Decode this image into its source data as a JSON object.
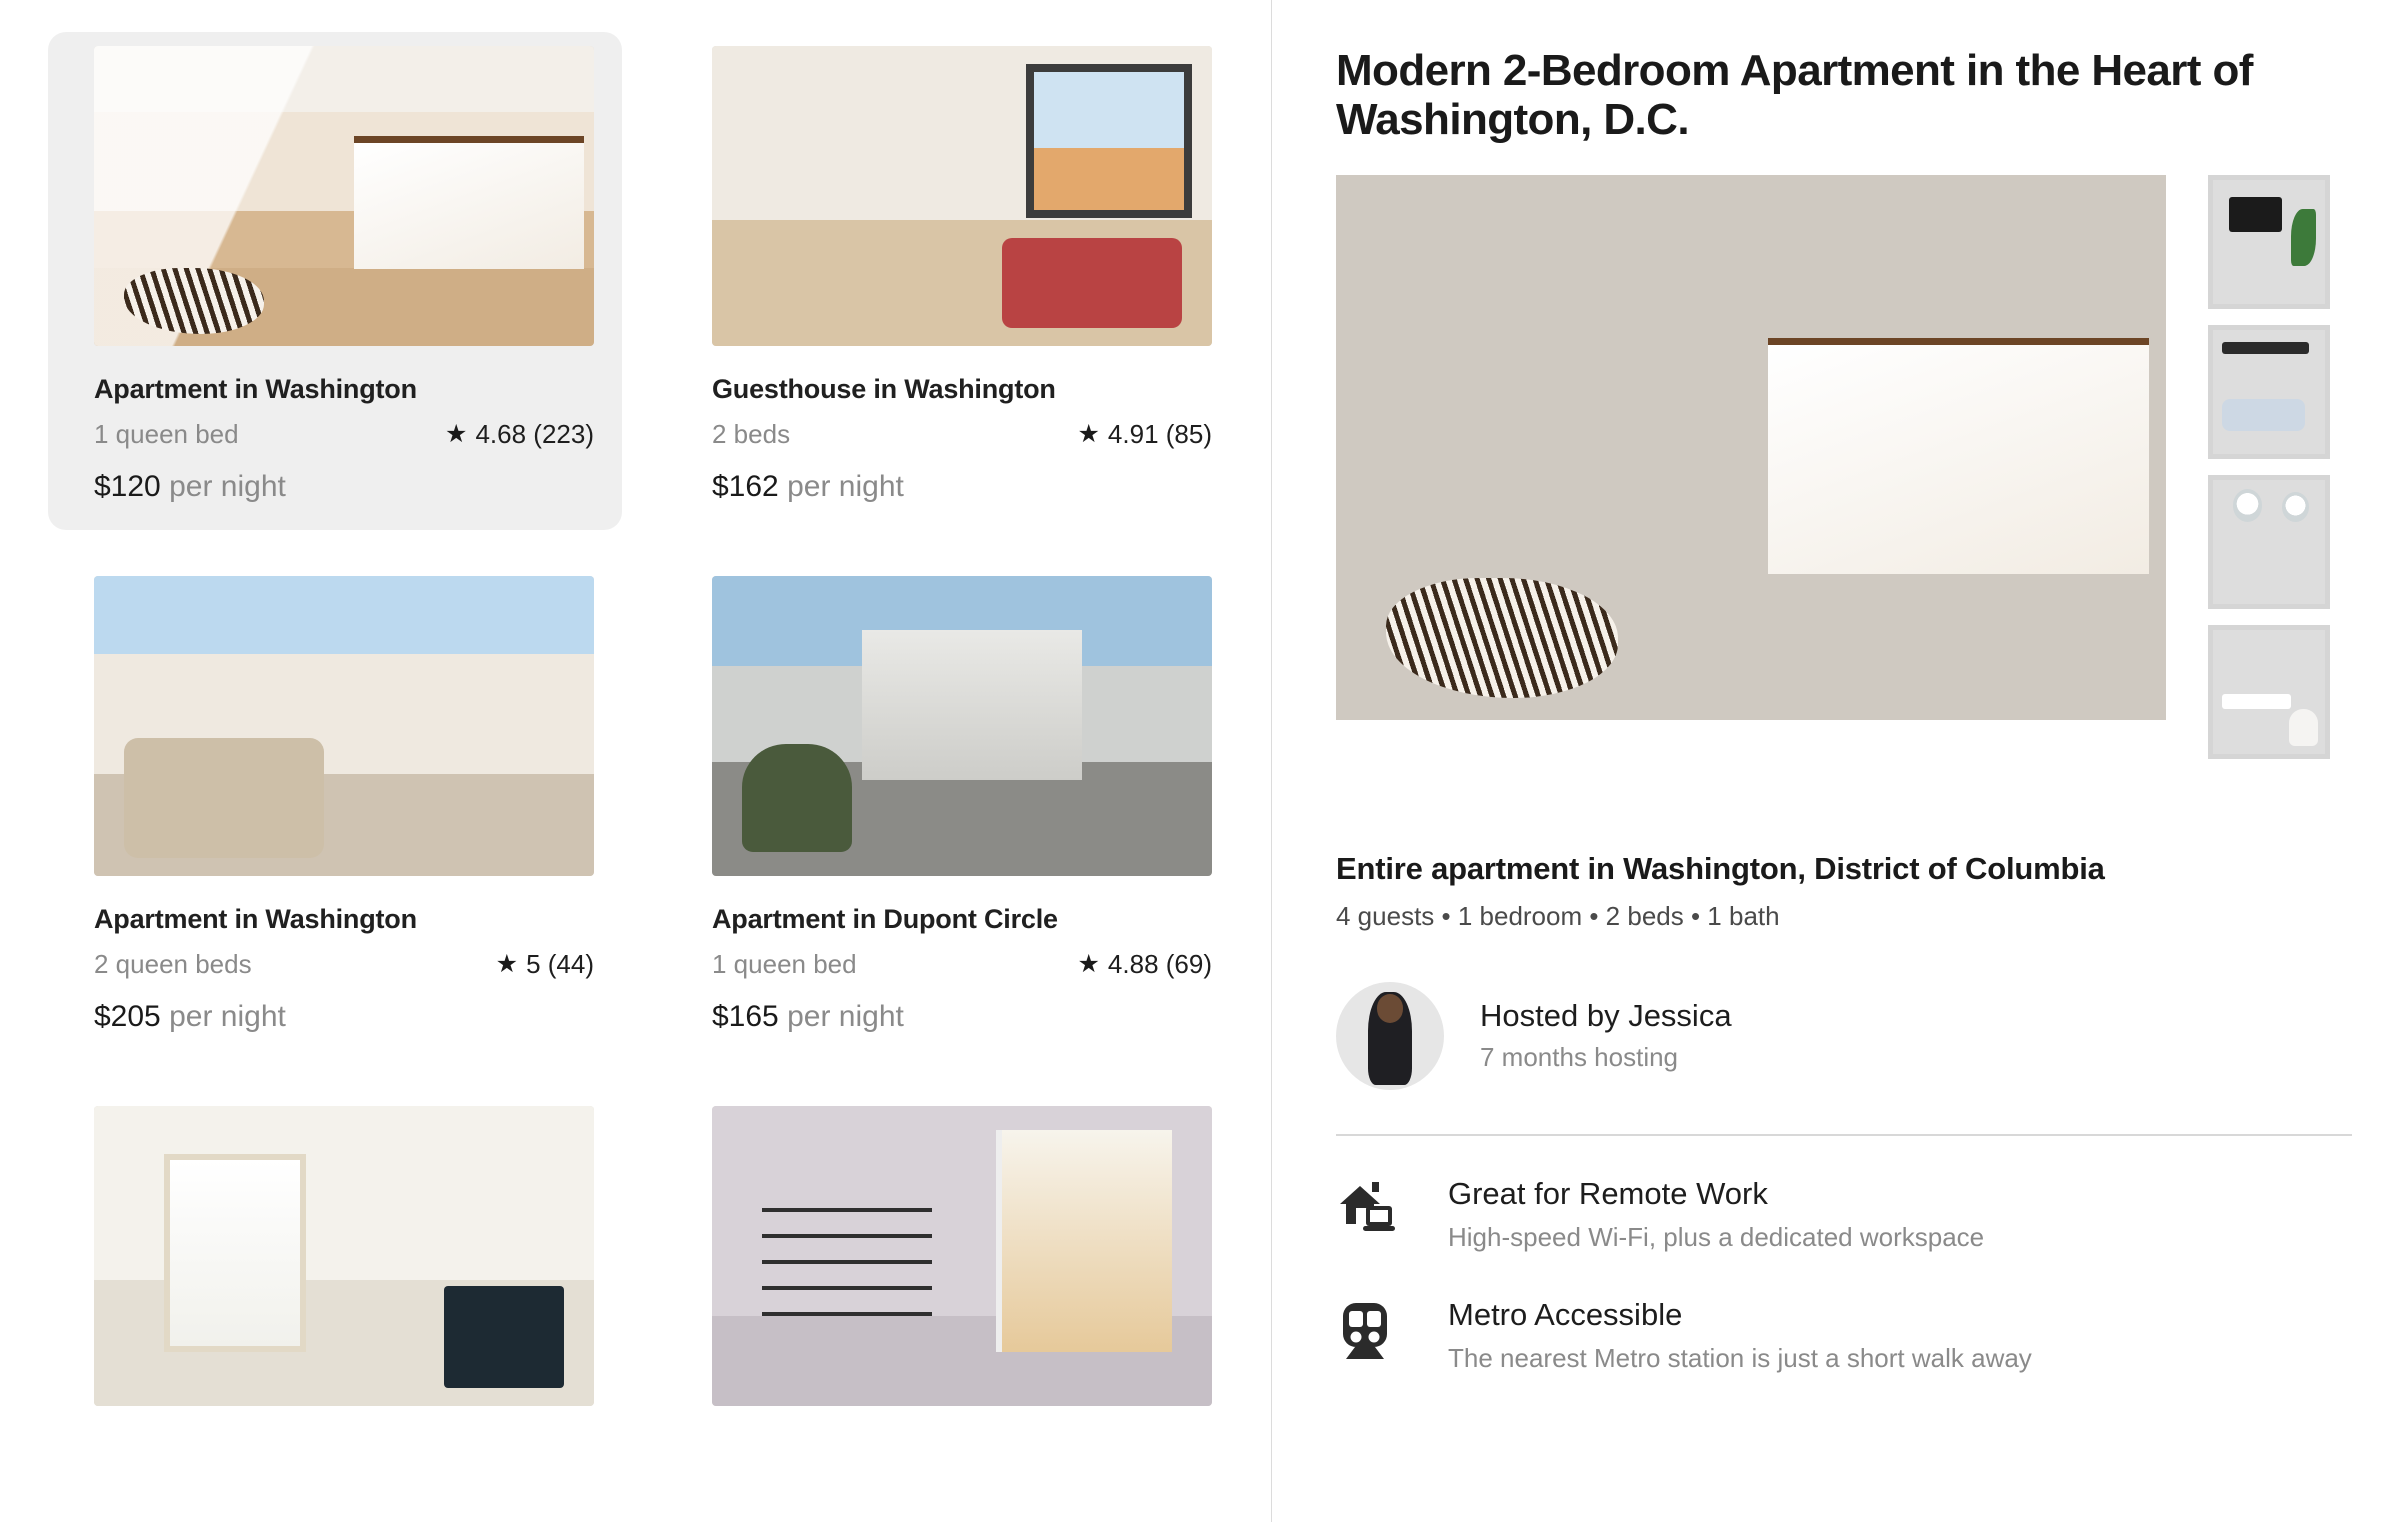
{
  "listings": [
    {
      "title": "Apartment in Washington",
      "beds": "1 queen bed",
      "rating": "4.68 (223)",
      "price_amount": "$120",
      "price_suffix": " per night",
      "selected": true,
      "photo": "bedroom-photo"
    },
    {
      "title": "Guesthouse in Washington",
      "beds": "2 beds",
      "rating": "4.91 (85)",
      "price_amount": "$162",
      "price_suffix": " per night",
      "selected": false,
      "photo": "guesthouse-photo"
    },
    {
      "title": "Apartment in Washington",
      "beds": "2 queen beds",
      "rating": "5 (44)",
      "price_amount": "$205",
      "price_suffix": " per night",
      "selected": false,
      "photo": "living-room-photo"
    },
    {
      "title": "Apartment in Dupont Circle",
      "beds": "1 queen bed",
      "rating": "4.88 (69)",
      "price_amount": "$165",
      "price_suffix": " per night",
      "selected": false,
      "photo": "balcony-photo"
    }
  ],
  "partial_listings": [
    {
      "photo": "curtained-window-photo"
    },
    {
      "photo": "shelves-window-photo"
    }
  ],
  "detail": {
    "title": "Modern 2-Bedroom Apartment in the Heart of Washington, D.C.",
    "hero_photo": "bedroom-hero-photo",
    "thumbnails": [
      {
        "photo": "tv-workspace-photo"
      },
      {
        "photo": "dining-room-photo"
      },
      {
        "photo": "kitchen-photo"
      },
      {
        "photo": "bathroom-photo"
      }
    ],
    "subtitle": "Entire apartment in Washington, District of Columbia",
    "facts": "4 guests • 1 bedroom • 2 beds • 1 bath",
    "host": {
      "name": "Hosted by Jessica",
      "tenure": "7 months hosting"
    },
    "amenities": [
      {
        "icon": "home-office-icon",
        "title": "Great for Remote Work",
        "description": "High-speed Wi-Fi, plus a dedicated workspace"
      },
      {
        "icon": "metro-train-icon",
        "title": "Metro Accessible",
        "description": "The nearest Metro station is just a short walk away"
      }
    ]
  },
  "icons": {
    "star": "★"
  },
  "colors": {
    "text_primary": "#1a1a1a",
    "text_muted": "#8a8a8a",
    "selected_card_bg": "#efefef",
    "divider": "#dcdcdc"
  }
}
